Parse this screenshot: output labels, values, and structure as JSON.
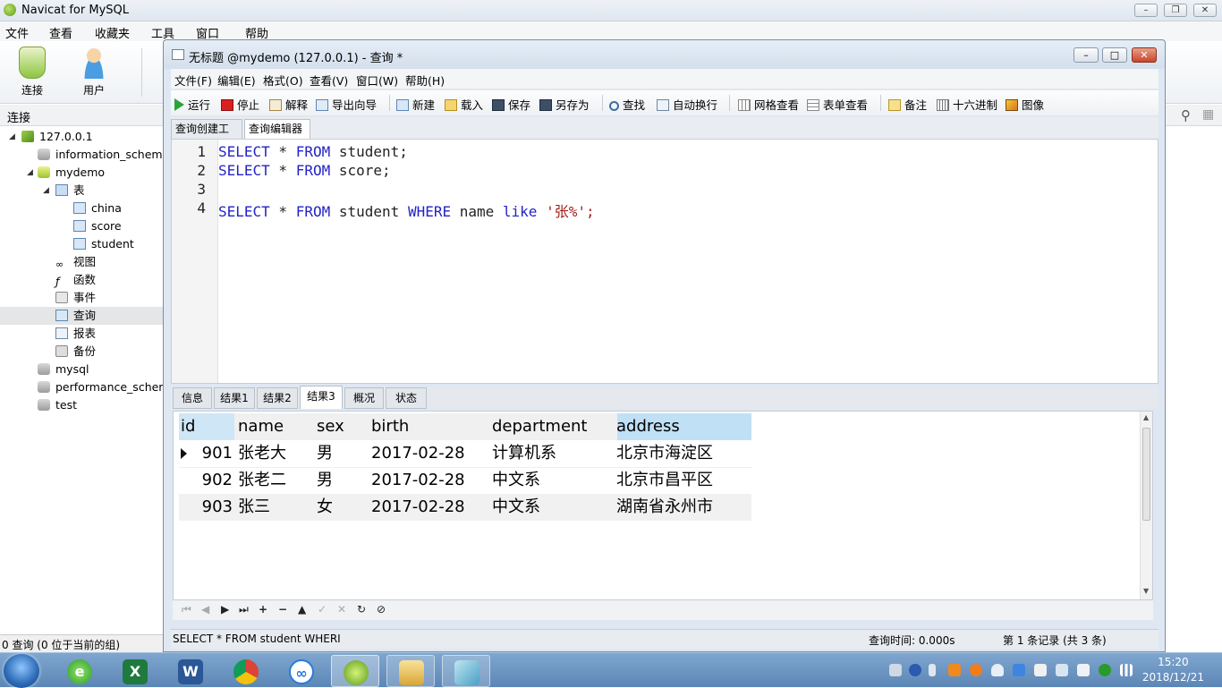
{
  "app": {
    "title": "Navicat for MySQL",
    "menu": [
      "文件",
      "查看",
      "收藏夹",
      "工具",
      "窗口",
      "帮助"
    ],
    "toolbar": {
      "connect": "连接",
      "user": "用户"
    },
    "connection_label": "连接"
  },
  "tree": [
    {
      "label": "127.0.0.1",
      "icon": "server-icon"
    },
    {
      "label": "information_schema",
      "icon": "database-icon"
    },
    {
      "label": "mydemo",
      "icon": "database-open-icon"
    },
    {
      "label": "表",
      "icon": "tables-icon"
    },
    {
      "label": "china",
      "icon": "table-icon"
    },
    {
      "label": "score",
      "icon": "table-icon"
    },
    {
      "label": "student",
      "icon": "table-icon"
    },
    {
      "label": "视图",
      "icon": "view-icon"
    },
    {
      "label": "函数",
      "icon": "function-icon"
    },
    {
      "label": "事件",
      "icon": "event-icon"
    },
    {
      "label": "查询",
      "icon": "query-icon"
    },
    {
      "label": "报表",
      "icon": "report-icon"
    },
    {
      "label": "备份",
      "icon": "backup-icon"
    },
    {
      "label": "mysql",
      "icon": "database-icon"
    },
    {
      "label": "performance_schema",
      "icon": "database-icon"
    },
    {
      "label": "test",
      "icon": "database-icon"
    }
  ],
  "status_left": "0 查询 (0 位于当前的组)",
  "query_window": {
    "title": "无标题 @mydemo (127.0.0.1) - 查询 *",
    "menu": [
      "文件(F)",
      "编辑(E)",
      "格式(O)",
      "查看(V)",
      "窗口(W)",
      "帮助(H)"
    ],
    "toolbar": [
      "运行",
      "停止",
      "解释",
      "导出向导",
      "新建",
      "载入",
      "保存",
      "另存为",
      "查找",
      "自动换行",
      "网格查看",
      "表单查看",
      "备注",
      "十六进制",
      "图像"
    ],
    "tabs": [
      "查询创建工具",
      "查询编辑器"
    ],
    "sql_lines": [
      {
        "n": "1",
        "kw1": "SELECT",
        "t1": " * ",
        "kw2": "FROM",
        "t2": " student;",
        "kw3": "",
        "t3": "",
        "kw4": "",
        "t4": ""
      },
      {
        "n": "2",
        "kw1": "SELECT",
        "t1": " * ",
        "kw2": "FROM",
        "t2": " score;",
        "kw3": "",
        "t3": "",
        "kw4": "",
        "t4": ""
      },
      {
        "n": "3",
        "kw1": "",
        "t1": "",
        "kw2": "",
        "t2": "",
        "kw3": "",
        "t3": "",
        "kw4": "",
        "t4": ""
      },
      {
        "n": "4",
        "kw1": "SELECT",
        "t1": " * ",
        "kw2": "FROM",
        "t2": " student ",
        "kw3": "WHERE",
        "t3": " name ",
        "kw4": "like",
        "t4": " '张%';"
      }
    ],
    "result_tabs": [
      "信息",
      "结果1",
      "结果2",
      "结果3",
      "概况",
      "状态"
    ],
    "columns": [
      "id",
      "name",
      "sex",
      "birth",
      "department",
      "address"
    ],
    "rows": [
      [
        "901",
        "张老大",
        "男",
        "2017-02-28",
        "计算机系",
        "北京市海淀区"
      ],
      [
        "902",
        "张老二",
        "男",
        "2017-02-28",
        "中文系",
        "北京市昌平区"
      ],
      [
        "903",
        "张三",
        "女",
        "2017-02-28",
        "中文系",
        "湖南省永州市"
      ]
    ],
    "status": {
      "sql": "SELECT * FROM student WHERI",
      "time": "查询时间: 0.000s",
      "records": "第 1 条记录 (共 3 条)"
    }
  },
  "taskbar": {
    "time": "15:20",
    "date": "2018/12/21"
  }
}
